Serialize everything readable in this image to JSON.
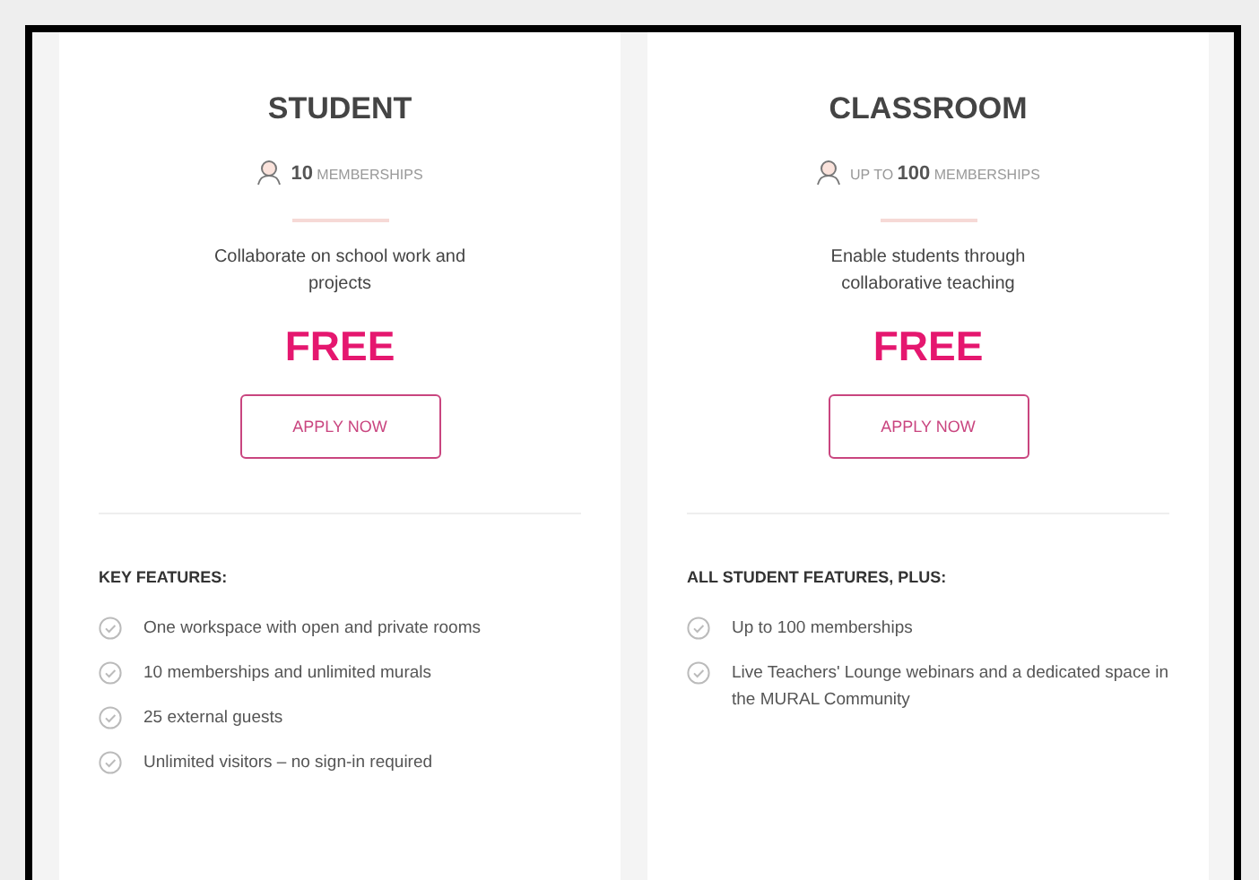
{
  "plans": [
    {
      "title": "STUDENT",
      "memberships": "**10** MEMBERSHIPS",
      "description": "Collaborate on school work and projects",
      "price": "FREE",
      "button": "APPLY NOW",
      "features_heading": "KEY FEATURES:",
      "features": [
        "One workspace with open and private rooms",
        "10 memberships and unlimited murals",
        "25 external guests",
        "Unlimited visitors – no sign-in required"
      ]
    },
    {
      "title": "CLASSROOM",
      "memberships": "UP TO **100** MEMBERSHIPS",
      "description": "Enable students through collaborative teaching",
      "price": "FREE",
      "button": "APPLY NOW",
      "features_heading": "ALL STUDENT FEATURES, PLUS:",
      "features": [
        "Up to 100 memberships",
        "Live Teachers' Lounge webinars and a dedicated space in the MURAL Community"
      ]
    }
  ]
}
